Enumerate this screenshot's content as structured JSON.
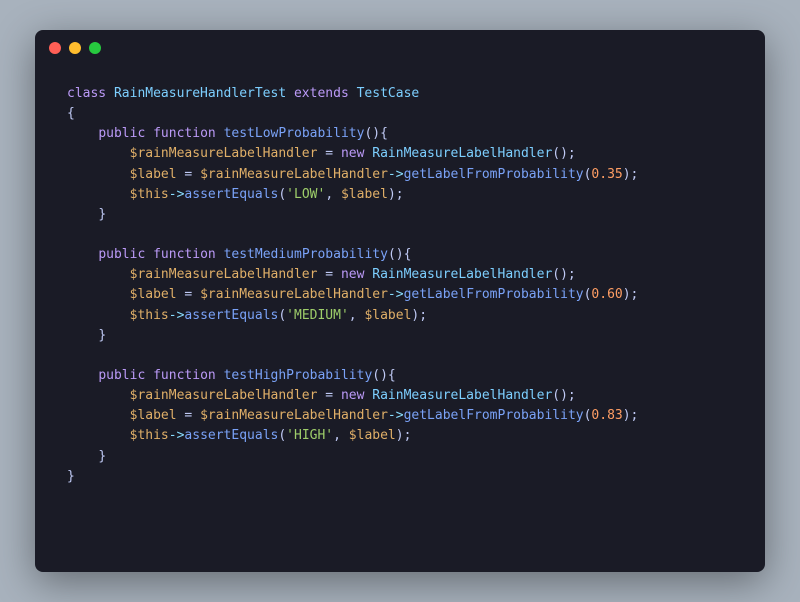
{
  "code": {
    "className": "RainMeasureHandlerTest",
    "extendsClass": "TestCase",
    "tests": [
      {
        "name": "testLowProbability",
        "handlerVar": "$rainMeasureLabelHandler",
        "handlerClass": "RainMeasureLabelHandler",
        "labelVar": "$label",
        "methodCall": "getLabelFromProbability",
        "probValue": "0.35",
        "thisVar": "$this",
        "assertMethod": "assertEquals",
        "expected": "'LOW'"
      },
      {
        "name": "testMediumProbability",
        "handlerVar": "$rainMeasureLabelHandler",
        "handlerClass": "RainMeasureLabelHandler",
        "labelVar": "$label",
        "methodCall": "getLabelFromProbability",
        "probValue": "0.60",
        "thisVar": "$this",
        "assertMethod": "assertEquals",
        "expected": "'MEDIUM'"
      },
      {
        "name": "testHighProbability",
        "handlerVar": "$rainMeasureLabelHandler",
        "handlerClass": "RainMeasureLabelHandler",
        "labelVar": "$label",
        "methodCall": "getLabelFromProbability",
        "probValue": "0.83",
        "thisVar": "$this",
        "assertMethod": "assertEquals",
        "expected": "'HIGH'"
      }
    ],
    "kwClass": "class",
    "kwExtends": "extends",
    "kwPublic": "public",
    "kwFunction": "function",
    "kwNew": "new"
  }
}
